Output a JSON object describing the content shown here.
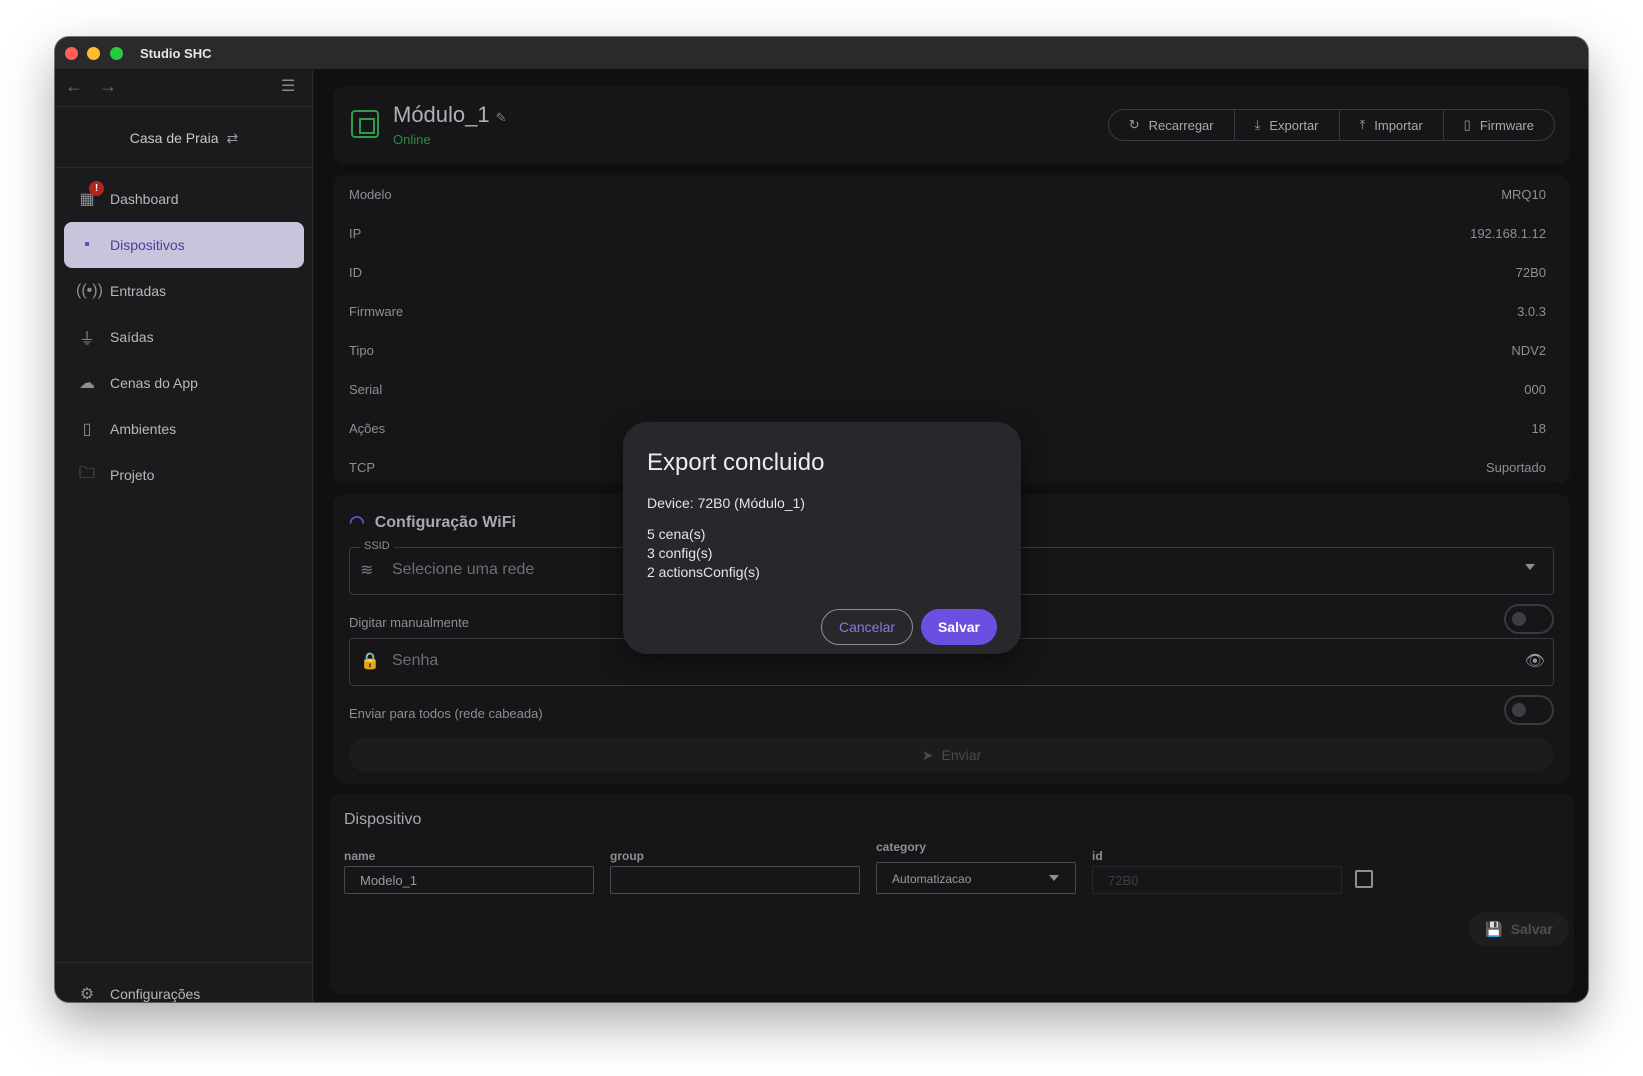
{
  "app": {
    "title": "Studio SHC"
  },
  "sidebar": {
    "workspace": "Casa de Praia",
    "badge": "!",
    "items": [
      {
        "label": "Dashboard",
        "icon": "dashboard-icon"
      },
      {
        "label": "Dispositivos",
        "icon": "devices-icon"
      },
      {
        "label": "Entradas",
        "icon": "inputs-icon"
      },
      {
        "label": "Saídas",
        "icon": "plug-icon"
      },
      {
        "label": "Cenas do App",
        "icon": "cloud-icon"
      },
      {
        "label": "Ambientes",
        "icon": "door-icon"
      },
      {
        "label": "Projeto",
        "icon": "folder-icon"
      }
    ],
    "settings": "Configurações"
  },
  "device": {
    "name": "Módulo_1",
    "status": "Online",
    "actions": [
      "Recarregar",
      "Exportar",
      "Importar",
      "Firmware"
    ]
  },
  "info": [
    {
      "key": "Modelo",
      "value": "MRQ10"
    },
    {
      "key": "IP",
      "value": "192.168.1.12"
    },
    {
      "key": "ID",
      "value": "72B0"
    },
    {
      "key": "Firmware",
      "value": "3.0.3"
    },
    {
      "key": "Tipo",
      "value": "NDV2"
    },
    {
      "key": "Serial",
      "value": "000"
    },
    {
      "key": "Ações",
      "value": "18"
    },
    {
      "key": "TCP",
      "value": "Suportado"
    }
  ],
  "wifi": {
    "title": "Configuração WiFi",
    "ssid_label": "SSID",
    "ssid_placeholder": "Selecione uma rede",
    "manual_label": "Digitar manualmente",
    "password_placeholder": "Senha",
    "send_all_label": "Enviar para todos (rede cabeada)",
    "send_button": "Enviar"
  },
  "form": {
    "title": "Dispositivo",
    "name_label": "name",
    "name_value": "Modelo_1",
    "group_label": "group",
    "group_value": "",
    "category_label": "category",
    "category_value": "Automatizacao",
    "id_label": "id",
    "id_value": "72B0",
    "save_button": "Salvar"
  },
  "dialog": {
    "title": "Export concluido",
    "device_line": "Device: 72B0 (Módulo_1)",
    "lines": [
      "5 cena(s)",
      "3 config(s)",
      "2 actionsConfig(s)"
    ],
    "cancel": "Cancelar",
    "confirm": "Salvar"
  },
  "colors": {
    "accent": "#6b4fe0",
    "online": "#2b8a3e",
    "active_nav_bg": "#c8c4dc",
    "badge": "#b3261e"
  }
}
